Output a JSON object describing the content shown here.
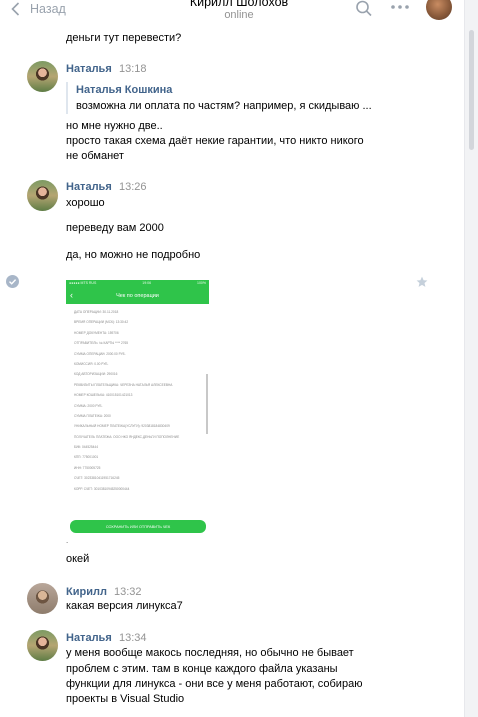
{
  "header": {
    "back_label": "Назад",
    "title": "Кирилл Шолохов",
    "status": "online"
  },
  "messages": {
    "prev_line": "деньги тут перевести?",
    "m1": {
      "author": "Наталья",
      "time": "13:18",
      "quote_author": "Наталья Кошкина",
      "quote_text": "возможна ли оплата по частям? например, я скидываю ...",
      "lines": [
        "но мне нужно две..",
        "просто такая схема даёт некие гарантии, что никто никого",
        "не обманет"
      ]
    },
    "m2": {
      "author": "Наталья",
      "time": "13:26",
      "line1": "хорошо",
      "line2": "переведу вам 2000",
      "line3": "да, но можно не подробно",
      "after_image": "окей"
    },
    "m3": {
      "author": "Кирилл",
      "time": "13:32",
      "line1": "какая версия линукса7"
    },
    "m4": {
      "author": "Наталья",
      "time": "13:34",
      "lines": [
        "у меня вообще макось последняя, но обычно не бывает",
        "проблем с этим. там в конце каждого файла указаны",
        "функции для линукса - они все у меня работают, собираю",
        "проекты в Visual Studio"
      ]
    }
  },
  "receipt": {
    "status_left": "●●●●● MTS RUS",
    "status_time": "19:06",
    "status_right": "100%",
    "nav_title": "Чек по операции",
    "rows": [
      "ДАТА ОПЕРАЦИИ: 30.11.2018",
      "ВРЕМЯ ОПЕРАЦИИ (МСК): 13:30:42",
      "НОМЕР ДОКУМЕНТА: 159706",
      "ОТПРАВИТЕЛЬ: № КАРТЫ **** 2765",
      "СУММА ОПЕРАЦИИ: 2000.00 РУБ.",
      "КОМИССИЯ: 0.00 РУБ.",
      "КОД АВТОРИЗАЦИИ: 290016",
      "РЕКВИЗИТЫ ПЛАТЕЛЬЩИКА: ЧЕРЕЗНА НАТАЛЬЯ АЛЕКСЕЕВНА",
      "НОМЕР КОШЕЛЬКА: 410015101421013",
      "СУММА: 2000 РУБ.",
      "СУММА ПЛАТЕЖА: 2000",
      "УНИКАЛЬНЫЙ НОМЕР ПЛАТЕЖА(УСЛУГИ): 9203818184830409",
      "ПОЛУЧАТЕЛЬ ПЛАТЕЖА: ООО НКО ЯНДЕКС.ДЕНЬГИ ПОПОЛНЕНИЕ",
      "БИК: 044525444",
      "КПП: 775001001",
      "ИНН: 7750005725",
      "СЧЕТ: 30233810411951716245",
      "КОРР. СЧЕТ: 30103810945250000444"
    ],
    "button_label": "СОХРАНИТЬ ИЛИ ОТПРАВИТЬ ЧЕК"
  }
}
